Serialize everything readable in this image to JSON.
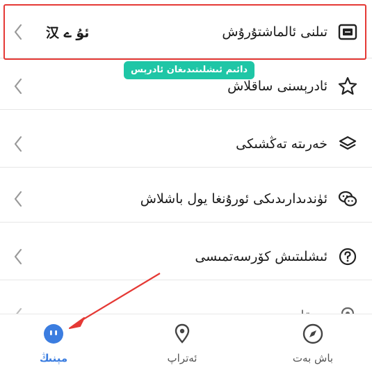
{
  "settings_list": {
    "items": [
      {
        "label": "تىلنى ئالماشتۇرۇش",
        "value": "ئۇ ے 汉",
        "icon": "language-switch-icon"
      },
      {
        "label": "ئادرېسنى ساقلاش",
        "value": "",
        "icon": "star-icon"
      },
      {
        "label": "خەرىتە تەڭشىكى",
        "value": "",
        "icon": "map-layers-icon"
      },
      {
        "label": "ئۈندىدارىدىكى ئورۇنغا يول باشلاش",
        "value": "",
        "icon": "wechat-icon"
      },
      {
        "label": "ئىشلىتىش كۆرسەتمىسى",
        "value": "",
        "icon": "help-circle-icon"
      },
      {
        "label": "...ىقا ...",
        "value": "",
        "icon": "location-pin-icon"
      }
    ]
  },
  "badge": {
    "text": "دائىم ئىشلىتىدىغان ئادرېس"
  },
  "tabbar": {
    "tabs": [
      {
        "label": "مېنىڭ",
        "icon": "robot-face-icon",
        "active": true
      },
      {
        "label": "ئەتراپ",
        "icon": "location-pin-icon",
        "active": false
      },
      {
        "label": "باش بەت",
        "icon": "compass-icon",
        "active": false
      }
    ]
  },
  "colors": {
    "accent": "#3b7de0",
    "highlight": "#e53935",
    "badge": "#1fc6a6"
  }
}
